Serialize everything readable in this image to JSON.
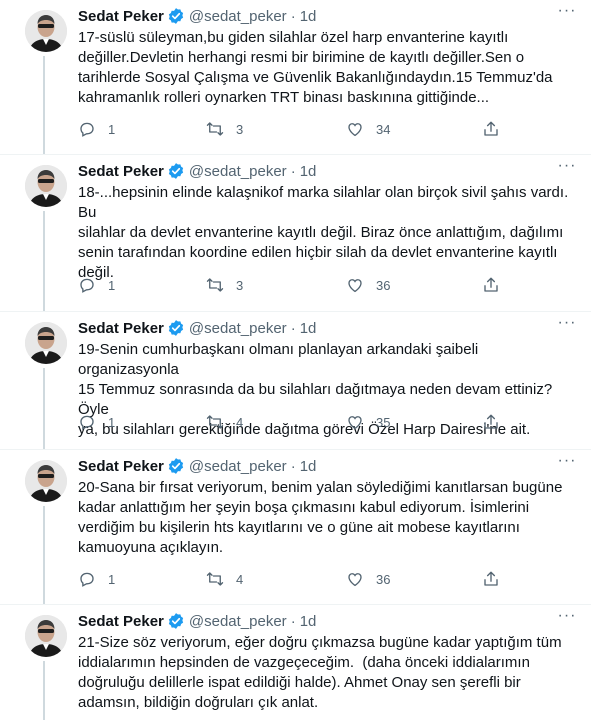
{
  "colors": {
    "text": "#0f1419",
    "secondary": "#536471",
    "verified": "#1d9bf0",
    "divider": "#eff3f4"
  },
  "tweets": [
    {
      "name": "Sedat Peker",
      "handle": "@sedat_peker",
      "dot": "·",
      "time": "1d",
      "text": "17-süslü süleyman,bu giden silahlar özel harp envanterine kayıtlı\ndeğiller.Devletin herhangi resmi bir birimine de kayıtlı değiller.Sen o\ntarihlerde Sosyal Çalışma ve Güvenlik Bakanlığındaydın.15 Temmuz'da\nkahramanlık rolleri oynarken TRT binası baskınına gittiğinde...",
      "replies": "1",
      "retweets": "3",
      "likes": "34"
    },
    {
      "name": "Sedat Peker",
      "handle": "@sedat_peker",
      "dot": "·",
      "time": "1d",
      "text": "18-...hepsinin elinde kalaşnikof marka silahlar olan birçok sivil şahıs vardı. Bu\nsilahlar da devlet envanterine kayıtlı değil. Biraz önce anlattığım, dağılımı\nsenin tarafından koordine edilen hiçbir silah da devlet envanterine kayıtlı\ndeğil.",
      "replies": "1",
      "retweets": "3",
      "likes": "36"
    },
    {
      "name": "Sedat Peker",
      "handle": "@sedat_peker",
      "dot": "·",
      "time": "1d",
      "text": "19-Senin cumhurbaşkanı olmanı planlayan arkandaki şaibeli organizasyonla\n15 Temmuz sonrasında da bu silahları dağıtmaya neden devam ettiniz? Öyle\nya, bu silahları gerektiğinde dağıtma görevi Özel Harp Dairesi'ne ait.",
      "replies": "1",
      "retweets": "4",
      "likes": "35"
    },
    {
      "name": "Sedat Peker",
      "handle": "@sedat_peker",
      "dot": "·",
      "time": "1d",
      "text": "20-Sana bir fırsat veriyorum, benim yalan söylediğimi kanıtlarsan bugüne\nkadar anlattığım her şeyin boşa çıkmasını kabul ediyorum. İsimlerini\nverdiğim bu kişilerin hts kayıtlarını ve o güne ait mobese kayıtlarını\nkamuoyuna açıklayın.",
      "replies": "1",
      "retweets": "4",
      "likes": "36"
    },
    {
      "name": "Sedat Peker",
      "handle": "@sedat_peker",
      "dot": "·",
      "time": "1d",
      "text": "21-Size söz veriyorum, eğer doğru çıkmazsa bugüne kadar yaptığım tüm\niddialarımın hepsinden de vazgeçeceğim.  (daha önceki iddialarımın\ndoğruluğu delillerle ispat edildiği halde). Ahmet Onay sen şerefli bir\nadamsın, bildiğin doğruları çık anlat.",
      "replies": "",
      "retweets": "",
      "likes": ""
    }
  ]
}
